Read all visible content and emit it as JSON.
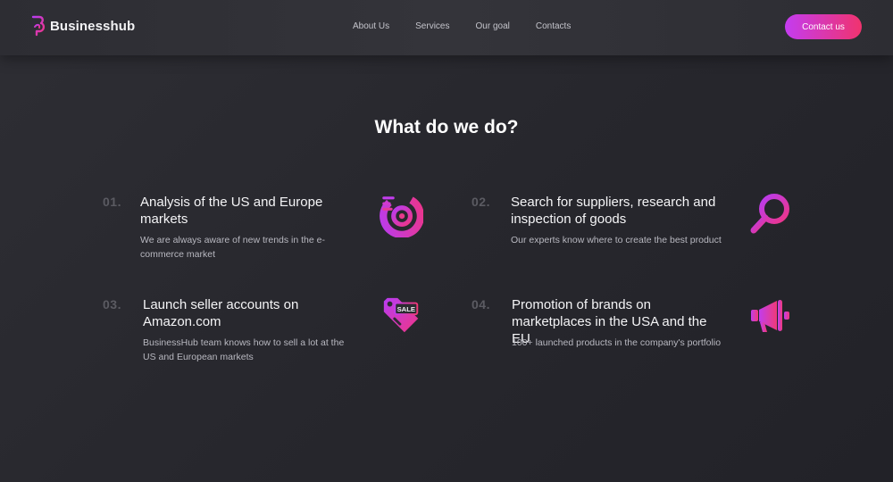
{
  "brand": {
    "name": "Businesshub",
    "accent_start": "#c43cf0",
    "accent_end": "#f0336e"
  },
  "nav": {
    "items": [
      {
        "label": "About Us"
      },
      {
        "label": "Services"
      },
      {
        "label": "Our goal"
      },
      {
        "label": "Contacts"
      }
    ],
    "cta_label": "Contact us"
  },
  "section": {
    "title": "What do we do?",
    "features": [
      {
        "num": "01.",
        "title": "Analysis of the US and Europe markets",
        "desc": "We are always aware of new trends in the e-commerce market",
        "icon": "target-chart-icon"
      },
      {
        "num": "02.",
        "title": "Search for suppliers, research and inspection of goods",
        "desc": "Our experts know where to create the best product",
        "icon": "magnifier-icon"
      },
      {
        "num": "03.",
        "title": "Launch seller accounts on Amazon.com",
        "desc": "BusinessHub team knows how to sell a lot at the US and European markets",
        "icon": "sale-tag-icon",
        "icon_text": "SALE"
      },
      {
        "num": "04.",
        "title": "Promotion of brands on marketplaces in the USA and the EU",
        "desc": "100+ launched products in the company's portfolio",
        "icon": "megaphone-icon"
      }
    ]
  }
}
